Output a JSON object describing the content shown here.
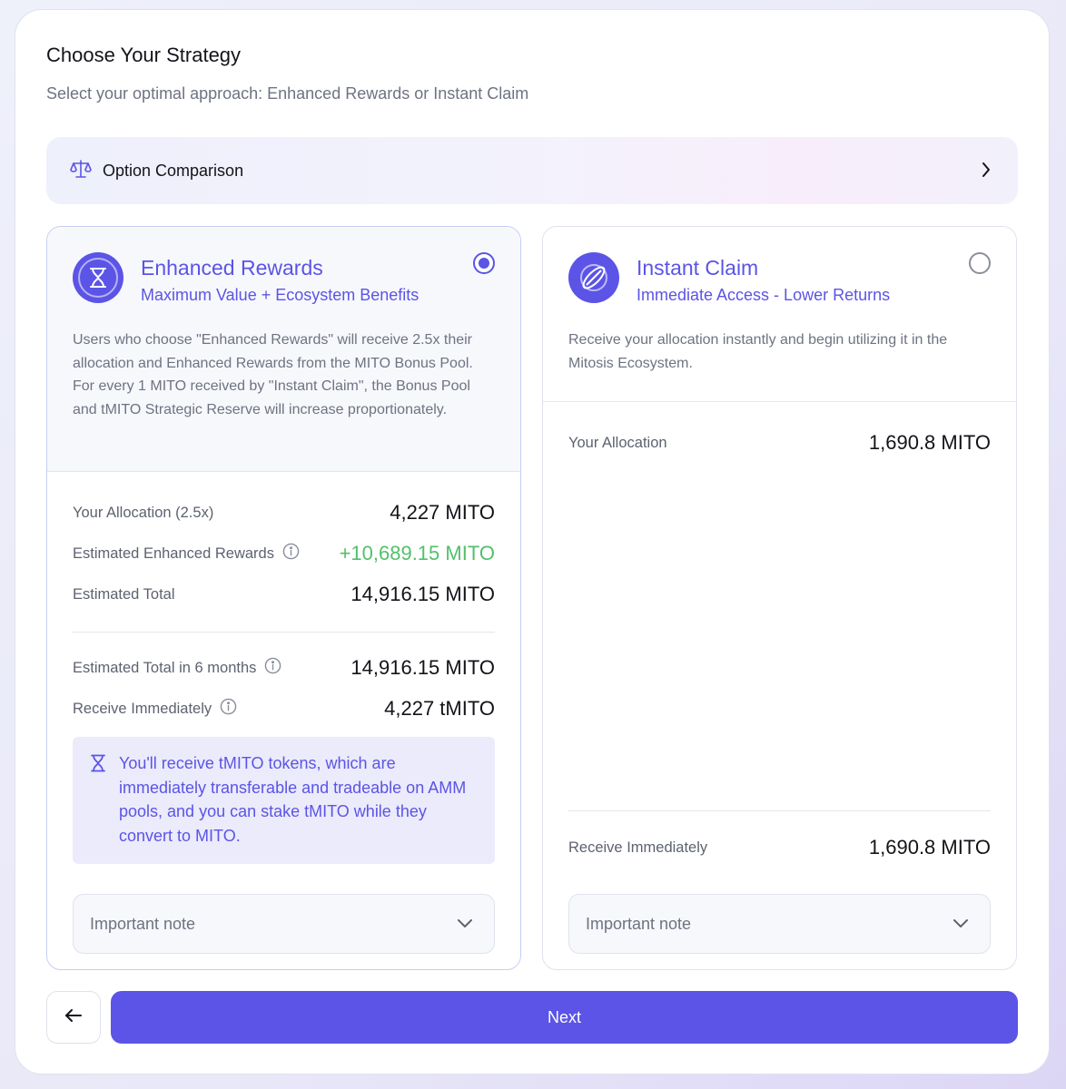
{
  "header": {
    "title": "Choose Your Strategy",
    "subtitle": "Select your optimal approach: Enhanced Rewards or Instant Claim"
  },
  "comparison": {
    "label": "Option Comparison",
    "icon": "scale-icon"
  },
  "enhanced": {
    "title": "Enhanced Rewards",
    "subtitle": "Maximum Value + Ecosystem Benefits",
    "selected": true,
    "description": "Users who choose \"Enhanced Rewards\" will receive 2.5x their allocation and Enhanced Rewards from the MITO Bonus Pool. For every 1 MITO received by \"Instant Claim\", the Bonus Pool and tMITO Strategic Reserve will increase proportionately.",
    "rows": [
      {
        "label": "Your Allocation (2.5x)",
        "value": "4,227 MITO"
      },
      {
        "label": "Estimated Enhanced Rewards",
        "value": "+10,689.15 MITO"
      },
      {
        "label": "Estimated Total",
        "value": "14,916.15 MITO"
      },
      {
        "label": "Estimated Total in 6 months",
        "value": "14,916.15 MITO"
      },
      {
        "label": "Receive Immediately",
        "value": "4,227 tMITO"
      }
    ],
    "note": "You'll receive tMITO tokens, which are immediately transferable and tradeable on AMM pools, and you can stake tMITO while they convert to MITO.",
    "dropdown_label": "Important note"
  },
  "instant": {
    "title": "Instant Claim",
    "subtitle": "Immediate Access - Lower Returns",
    "selected": false,
    "description": "Receive your allocation instantly and begin utilizing it in the Mitosis Ecosystem.",
    "rows": [
      {
        "label": "Your Allocation",
        "value": "1,690.8 MITO"
      },
      {
        "label": "Receive Immediately",
        "value": "1,690.8 MITO"
      }
    ],
    "dropdown_label": "Important note"
  },
  "footer": {
    "next_label": "Next"
  },
  "colors": {
    "accent": "#5b54e6",
    "positive": "#53c06b"
  }
}
